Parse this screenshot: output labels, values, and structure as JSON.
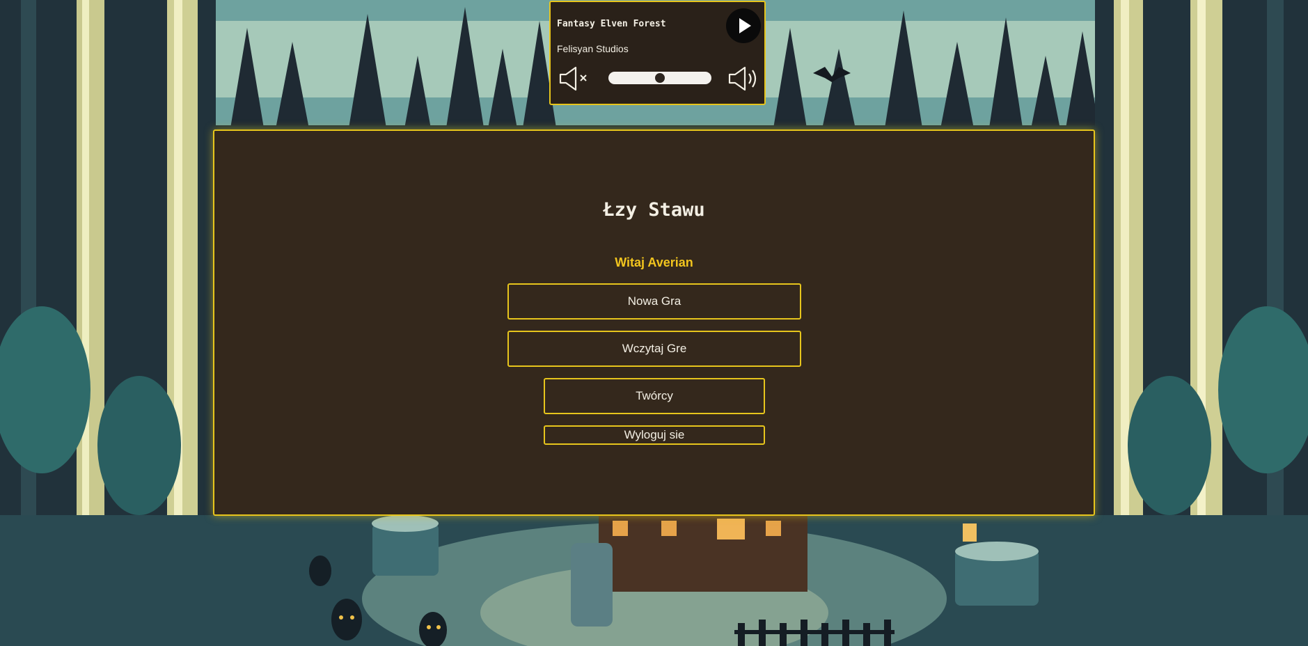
{
  "player": {
    "track_title": "Fantasy Elven Forest",
    "artist": "Felisyan Studios",
    "play_icon": "play-icon",
    "mute_icon": "speaker-muted-icon",
    "loud_icon": "speaker-loud-icon",
    "volume_percent": 50
  },
  "menu": {
    "title": "Łzy Stawu",
    "welcome": "Witaj Averian",
    "new_game": "Nowa Gra",
    "load_game": "Wczytaj Gre",
    "credits": "Twórcy",
    "logout": "Wyloguj sie"
  },
  "colors": {
    "accent": "#e7c51c",
    "welcome_text": "#f2c51e",
    "panel_bg": "#36281a",
    "text": "#f3efe4"
  }
}
